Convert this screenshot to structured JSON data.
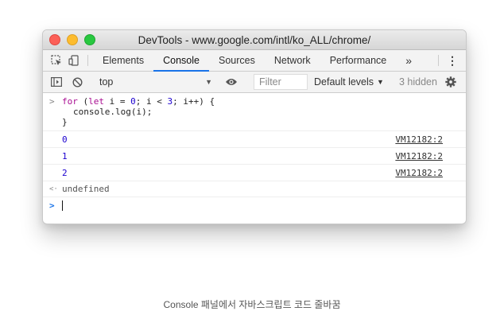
{
  "window": {
    "title": "DevTools - www.google.com/intl/ko_ALL/chrome/"
  },
  "tabs": [
    "Elements",
    "Console",
    "Sources",
    "Network",
    "Performance"
  ],
  "tabs_overflow": "»",
  "more_menu": "⋮",
  "toolbar": {
    "context": "top",
    "filter_placeholder": "Filter",
    "levels_label": "Default levels",
    "hidden_label": "3 hidden"
  },
  "console": {
    "input_prompt": ">",
    "code": {
      "line1": {
        "kw1": "for",
        "t1": " (",
        "kw2": "let",
        "t2": " i = ",
        "n1": "0",
        "t3": "; i < ",
        "n2": "3",
        "t4": "; i++) {"
      },
      "line2": "console.log(i);",
      "line3": "}"
    },
    "logs": [
      {
        "value": "0",
        "source": "VM12182:2"
      },
      {
        "value": "1",
        "source": "VM12182:2"
      },
      {
        "value": "2",
        "source": "VM12182:2"
      }
    ],
    "return_marker": "<·",
    "return_value": "undefined",
    "prompt_marker": ">"
  },
  "caption": "Console 패널에서 자바스크립트 코드 줄바꿈"
}
